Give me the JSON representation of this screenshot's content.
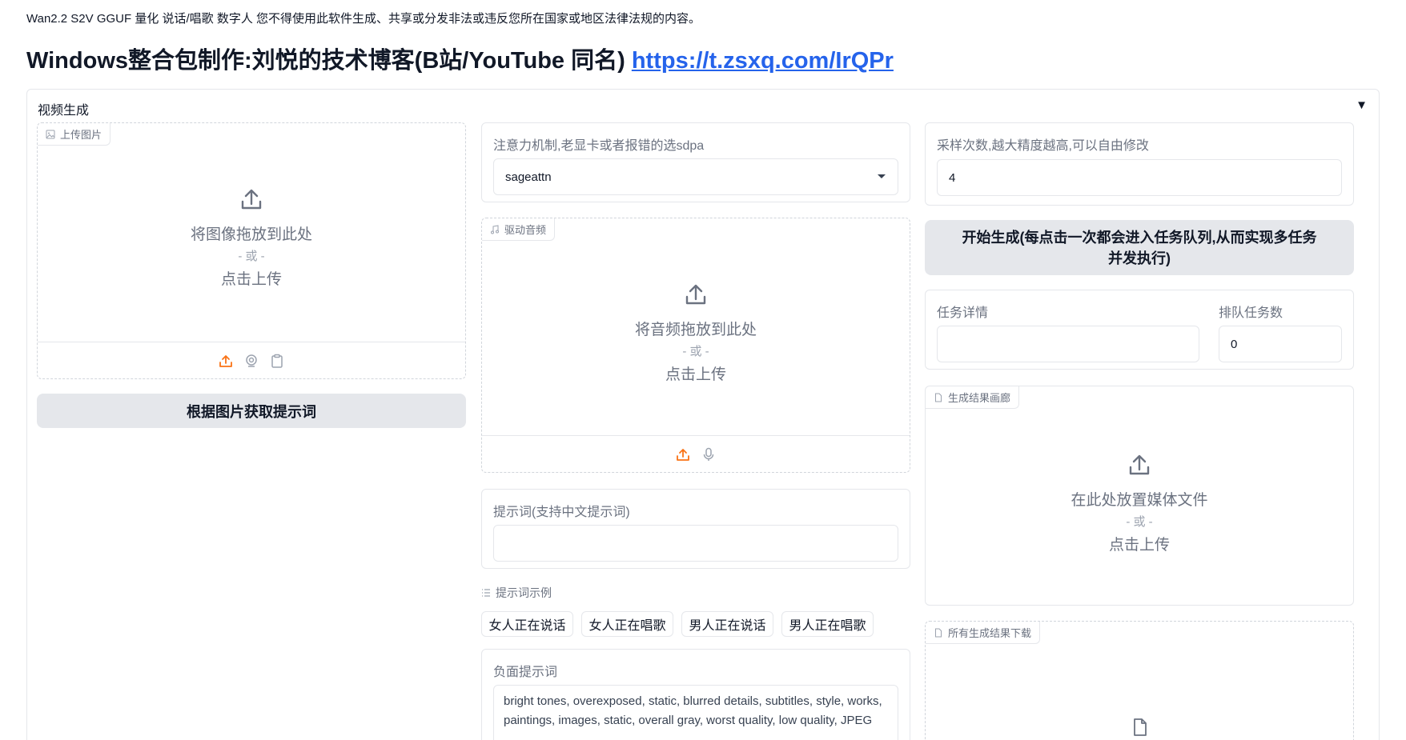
{
  "notice": "Wan2.2 S2V GGUF 量化 说话/唱歌 数字人 您不得使用此软件生成、共享或分发非法或违反您所在国家或地区法律法规的内容。",
  "heading": {
    "text": "Windows整合包制作:刘悦的技术博客(B站/YouTube 同名) ",
    "link": "https://t.zsxq.com/IrQPr"
  },
  "panel": {
    "title": "视频生成",
    "toggle": "▼"
  },
  "image_upload": {
    "chip": "上传图片",
    "drop_text": "将图像拖放到此处",
    "or_text": "- 或 -",
    "click_text": "点击上传",
    "icons": [
      "upload-icon",
      "webcam-icon",
      "clipboard-icon"
    ]
  },
  "prompt_from_image_button": "根据图片获取提示词",
  "attention": {
    "label": "注意力机制,老显卡或者报错的选sdpa",
    "value": "sageattn"
  },
  "audio_upload": {
    "chip": "驱动音频",
    "drop_text": "将音频拖放到此处",
    "or_text": "- 或 -",
    "click_text": "点击上传",
    "icons": [
      "upload-icon",
      "microphone-icon"
    ]
  },
  "prompt": {
    "label": "提示词(支持中文提示词)",
    "value": ""
  },
  "examples": {
    "label": "提示词示例",
    "items": [
      "女人正在说话",
      "女人正在唱歌",
      "男人正在说话",
      "男人正在唱歌"
    ]
  },
  "negative_prompt": {
    "label": "负面提示词",
    "value": "bright tones, overexposed, static, blurred details, subtitles, style, works, paintings, images, static, overall gray, worst quality, low quality, JPEG"
  },
  "steps": {
    "label": "采样次数,越大精度越高,可以自由修改",
    "value": "4"
  },
  "generate_button": "开始生成(每点击一次都会进入任务队列,从而实现多任务并发执行)",
  "task_details": {
    "label": "任务详情",
    "value": ""
  },
  "queue_count": {
    "label": "排队任务数",
    "value": "0"
  },
  "gallery": {
    "chip": "生成结果画廊",
    "drop_text": "在此处放置媒体文件",
    "or_text": "- 或 -",
    "click_text": "点击上传"
  },
  "downloads": {
    "chip": "所有生成结果下载"
  },
  "colors": {
    "accent": "#f97316",
    "button_bg": "#e5e7eb",
    "link": "#2563eb",
    "border": "#e5e7eb"
  }
}
